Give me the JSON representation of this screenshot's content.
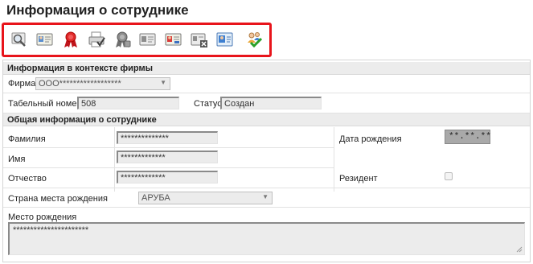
{
  "page": {
    "title": "Информация о сотруднике"
  },
  "toolbar": {
    "icons": [
      "search-icon",
      "id-card-icon",
      "award-ribbon-icon",
      "print-check-icon",
      "grey-ribbon-icon",
      "contact-card-icon",
      "person-card-icon",
      "delete-card-icon",
      "person-photo-card-icon",
      "users-check-icon"
    ],
    "accent": "#e8141b"
  },
  "firm_section": {
    "header": "Информация в контексте фирмы",
    "firm_label": "Фирма",
    "firm_value": "ООО******************",
    "tab_label": "Табельный номер",
    "tab_value": "508",
    "status_label": "Статус",
    "status_value": "Создан"
  },
  "general_section": {
    "header": "Общая информация о сотруднике",
    "lastname_label": "Фамилия",
    "lastname_value": "**************",
    "firstname_label": "Имя",
    "firstname_value": "*************",
    "patronymic_label": "Отчество",
    "patronymic_value": "*************",
    "birthdate_label": "Дата рождения",
    "birthdate_value": "**.**.**",
    "resident_label": "Резидент",
    "birth_country_label": "Страна места рождения",
    "birth_country_value": "АРУБА",
    "birthplace_label": "Место рождения",
    "birthplace_value": "**********************"
  }
}
